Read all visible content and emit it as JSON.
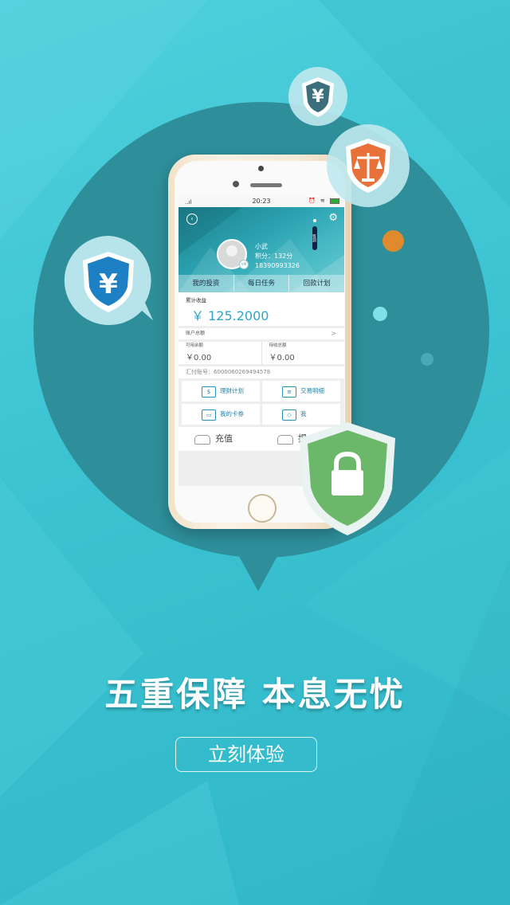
{
  "status_bar": {
    "time": "20:23",
    "signal": "..ıl",
    "icons": "⏰ ≋"
  },
  "profile": {
    "user_name": "小武",
    "points": "积分：132分",
    "phone": "18390993326",
    "sign_label": "签到",
    "vip_label": "VIP"
  },
  "tabs": [
    "我的投资",
    "每日任务",
    "回款计划"
  ],
  "earnings": {
    "label": "累计收益",
    "value": "￥ 125.2000"
  },
  "account": {
    "total_label": "账户总额",
    "arrow": ">",
    "available_label": "可用余额",
    "available_value": "￥0.00",
    "pending_label": "待收总额",
    "pending_value": "￥0.00",
    "bank_no": "汇付账号：6000060269494578"
  },
  "grid_items": [
    {
      "label": "理财计划",
      "icon": "plan-icon",
      "glyph": "$"
    },
    {
      "label": "交易明细",
      "icon": "document-icon",
      "glyph": "≡"
    },
    {
      "label": "我的卡券",
      "icon": "coupon-icon",
      "glyph": "▭"
    },
    {
      "label": "我",
      "icon": "diamond-icon",
      "glyph": "◇"
    }
  ],
  "actions": [
    {
      "label": "充值",
      "icon": "recharge-icon"
    },
    {
      "label": "提",
      "icon": "withdraw-icon"
    }
  ],
  "badges": {
    "yen_symbol": "¥"
  },
  "headline": "五重保障  本息无忧",
  "cta_label": "立刻体验",
  "colors": {
    "background": "#3cc3d2",
    "bubble": "#2e8f9b",
    "shield_blue": "#1d7fc4",
    "shield_orange": "#e8713a",
    "shield_green": "#6cb86a",
    "accent_value": "#2fa6c4"
  }
}
